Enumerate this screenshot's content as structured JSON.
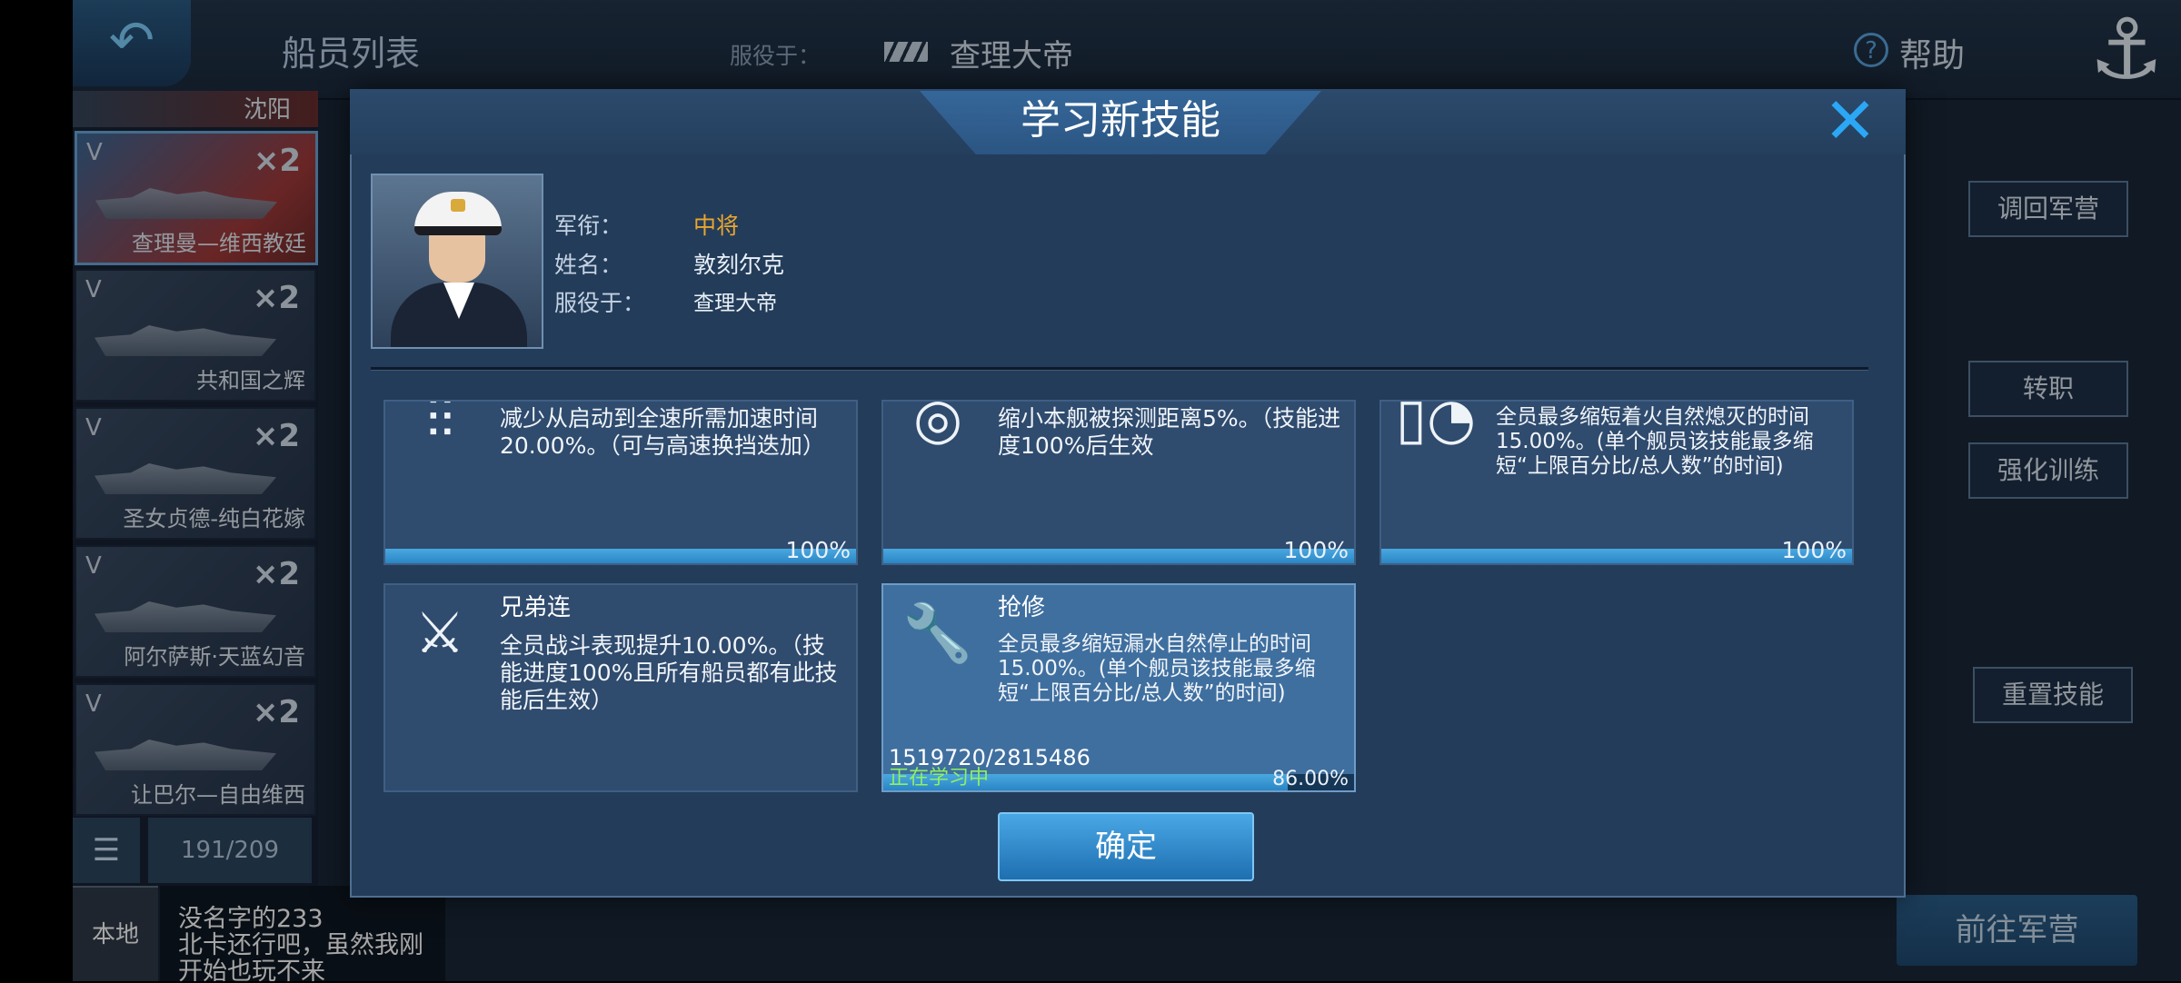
{
  "topbar": {
    "crew_list_title": "船员列表",
    "serving_label": "服役于：",
    "serving_ship": "查理大帝",
    "help_label": "帮助",
    "help_icon": "help-icon",
    "back_icon": "back-arrow-icon",
    "anchor_icon": "anchor-icon"
  },
  "ship_list": {
    "top_partial_name": "沈阳",
    "ships": [
      {
        "rank": "V",
        "multiplier": "×2",
        "name": "查理曼—维西教廷"
      },
      {
        "rank": "V",
        "multiplier": "×2",
        "name": "共和国之辉"
      },
      {
        "rank": "V",
        "multiplier": "×2",
        "name": "圣女贞德-纯白花嫁"
      },
      {
        "rank": "V",
        "multiplier": "×2",
        "name": "阿尔萨斯·天蓝幻音"
      },
      {
        "rank": "V",
        "multiplier": "×2",
        "name": "让巴尔—自由维西"
      }
    ],
    "count": "191/209",
    "list_icon": "list-icon"
  },
  "right_panel": {
    "recall_button": "调回军营",
    "transfer_button": "转职",
    "training_button": "强化训练",
    "reset_button": "重置技能",
    "goto_barracks_button": "前往军营"
  },
  "chat": {
    "tab_label": "本地",
    "lines": [
      "没名字的233",
      "北卡还行吧，虽然我刚",
      "开始也玩不来"
    ]
  },
  "modal": {
    "title": "学习新技能",
    "close_icon": "close-icon",
    "officer": {
      "rank_label": "军衔：",
      "rank_value": "中将",
      "name_label": "姓名：",
      "name_value": "敦刻尔克",
      "serving_label": "服役于：",
      "serving_value": "查理大帝"
    },
    "skills": [
      {
        "icon": "acceleration-icon",
        "description": "减少从启动到全速所需加速时间20.00%。（可与高速换挡迭加）",
        "percent_label": "100%",
        "progress": 1.0
      },
      {
        "icon": "radar-concealment-icon",
        "description": "缩小本舰被探测距离5%。（技能进度100%后生效",
        "percent_label": "100%",
        "progress": 1.0
      },
      {
        "icon": "fire-extinguish-icon",
        "description": "全员最多缩短着火自然熄灭的时间15.00%。(单个舰员该技能最多缩短“上限百分比/总人数”的时间)",
        "percent_label": "100%",
        "progress": 1.0
      },
      {
        "icon": "brotherhood-icon",
        "name": "兄弟连",
        "description": "全员战斗表现提升10.00%。（技能进度100%且所有船员都有此技能后生效）"
      },
      {
        "icon": "repair-icon",
        "name": "抢修",
        "description": "全员最多缩短漏水自然停止的时间15.00%。(单个舰员该技能最多缩短“上限百分比/总人数”的时间)",
        "progress_text": "1519720/2815486",
        "status": "正在学习中",
        "percent_label": "86.00%",
        "progress": 0.86
      }
    ],
    "confirm_button": "确定"
  },
  "colors": {
    "accent": "#2ba7f5",
    "rank_gold": "#e9a630",
    "learning_green": "#8ef063",
    "modal_bg": "#233c59"
  }
}
